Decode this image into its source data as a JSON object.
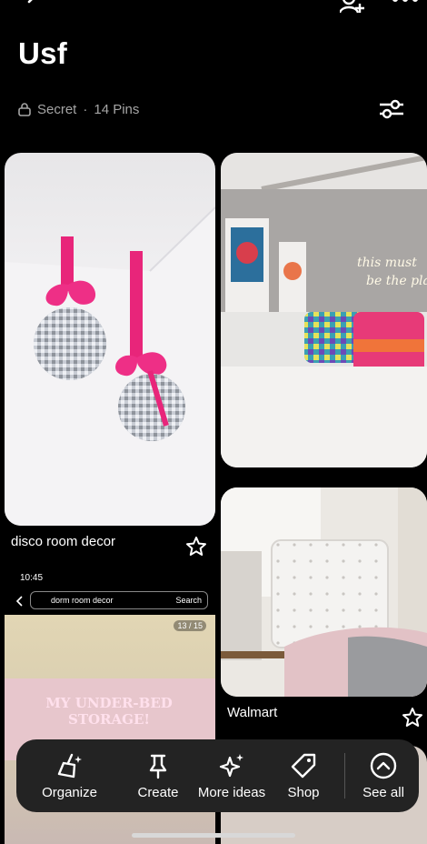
{
  "board": {
    "title": "Usf",
    "privacy": "Secret",
    "separator": "·",
    "pin_count": "14 Pins"
  },
  "icons": {
    "back": "back-arrow-icon",
    "collaborator": "add-collaborator-icon",
    "more": "more-icon",
    "lock": "lock-icon",
    "filter": "filter-sliders-icon",
    "star": "star-icon"
  },
  "pins": [
    {
      "title": "disco room decor"
    },
    {
      "title": ""
    },
    {
      "title": ""
    },
    {
      "title": "Walmart"
    }
  ],
  "screenshot_pin": {
    "time": "10:45",
    "search_query": "dorm room decor",
    "search_button": "Search",
    "counter": "13 / 15",
    "overlay_text_line1": "MY UNDER-BED",
    "overlay_text_line2": "STORAGE!"
  },
  "toolbar": {
    "organize": "Organize",
    "create": "Create",
    "more_ideas": "More ideas",
    "shop": "Shop",
    "see_all": "See all"
  },
  "colors": {
    "background": "#000000",
    "toolbar": "#232323",
    "secondary_text": "#a5a5a5",
    "accent_pink": "#e8257a"
  }
}
